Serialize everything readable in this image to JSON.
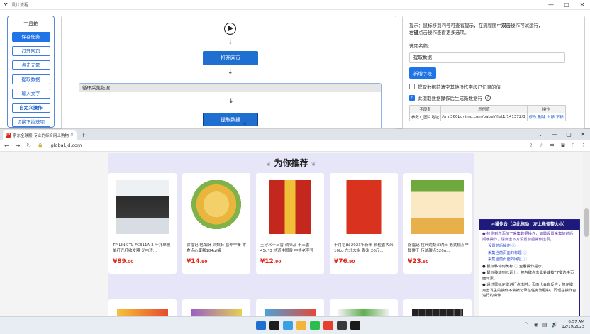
{
  "app": {
    "title": "设计流程",
    "minimize": "—",
    "maximize": "▢",
    "close": "✕",
    "toolbox": {
      "title": "工具箱",
      "buttons": [
        "保存任务",
        "打开网页",
        "点击元素",
        "提取数据",
        "输入文字",
        "自定义操作",
        "切换下拉选项"
      ]
    },
    "flow": {
      "nodes": {
        "open_page": "打开网页",
        "loop": "循环采集数据",
        "extract": "提取数据"
      },
      "arrow": "↓"
    },
    "props": {
      "tip_prefix": "提示：鼠标移到问号可查看提示，在流程图中",
      "tip_bold1": "双击",
      "tip_mid": "操作可试运行，",
      "tip_bold2": "右键",
      "tip_suffix": "点击操作查看更多选项。",
      "option_name_label": "选项名称:",
      "option_name_value": "提取数据",
      "add_field_button": "新增字段",
      "checkbox1": "提取数据前清空其他操作字段已记录的值",
      "checkbox2": "此提取数据操作后生成新数据行",
      "info_glyph": "?",
      "table": {
        "headers": [
          "字段名",
          "示例值",
          "操作"
        ],
        "rows": [
          [
            "参数1_图片地址",
            "//m.360buyimg.com/babel/jfs/t1/141372/3",
            "修改 删除 上移 下移"
          ]
        ]
      }
    }
  },
  "browser": {
    "tab_title": "京东全球版-专业的综合网上购物",
    "tab_favicon": "JD",
    "tab_close": "✕",
    "new_tab": "+",
    "nav": {
      "back": "←",
      "forward": "→",
      "reload": "↻",
      "lock": "🔒"
    },
    "url": "global.jd.com",
    "window_controls": {
      "dropdown": "⌄",
      "minimize": "—",
      "maximize": "▢",
      "close": "✕"
    },
    "toolbar_icons": [
      "⇪",
      "☆",
      "✱",
      "▣",
      "▯",
      "⋮"
    ],
    "section_title": "为你推荐",
    "products": [
      {
        "name": "TP-LINK TL-FC311A-3 千兆单模单纤光纤收发器 光电转...",
        "price_symbol": "¥",
        "price_int": "89",
        "price_dec": ".00",
        "colors": [
          "#2b2b2b",
          "#d8dde4"
        ]
      },
      {
        "name": "徐福记 包馅酥 凤梨酥 营养早餐 零食点心蛋糕184g/袋",
        "price_symbol": "¥",
        "price_int": "14",
        "price_dec": ".90",
        "colors": [
          "#e9b53c",
          "#7fb34a"
        ]
      },
      {
        "name": "王守义十三香 调味品 十三香45g*3 地道中国香 中华老字号",
        "price_symbol": "¥",
        "price_int": "12",
        "price_dec": ".90",
        "colors": [
          "#c3271d",
          "#f0c038"
        ]
      },
      {
        "name": "十月稻田 2023年新米 长粒香大米 10kg 东北大米 香米 20斤...",
        "price_symbol": "¥",
        "price_int": "76",
        "price_dec": ".90",
        "colors": [
          "#d9321f",
          "#f3e7c9"
        ]
      },
      {
        "name": "徐福记 拉典炖梨沙琪玛 老式糕点早餐饼干 传统甜点526g...",
        "price_symbol": "¥",
        "price_int": "23",
        "price_dec": ".90",
        "colors": [
          "#e8b04a",
          "#6fa83c"
        ]
      }
    ],
    "console": {
      "title": "✍操作台（点此拖动，左上角调整大小）",
      "lines": [
        {
          "kind": "purple",
          "text": "● 检测到您添加了采集数据操作，如需设置采集的前后顺序操作，请点击下方设置前后操作选项。"
        },
        {
          "kind": "link",
          "text": "设置前后操作 ⓘ"
        },
        {
          "kind": "link",
          "text": "采集当前页面的标题 ⓘ"
        },
        {
          "kind": "link",
          "text": "采集当前页面的网址 ⓘ"
        },
        {
          "kind": "black",
          "text": "● 鼠标移动到黄标 ⓘ 查看操作提示。"
        },
        {
          "kind": "black",
          "text": "● 鼠标移动到元素上，按右键点击此处或按F7键选中页面元素。"
        },
        {
          "kind": "black",
          "text": "● 通过鼠标左键进行点击时，页面也会有反应，但左键点击发生的操作不会被记录在任务流程中，同理在操作台进行的操作..."
        }
      ]
    }
  },
  "taskbar": {
    "chevron": "^",
    "tray_symbols": [
      "◉",
      "▤",
      "🔊"
    ],
    "time": "6:57 AM",
    "date": "12/19/2023",
    "app_colors": [
      "#1d1d1d",
      "#3aa0e6",
      "#f3b43a",
      "#2dbd4e",
      "#e83e2e",
      "#3a3a3a",
      "#1a1a1a"
    ]
  }
}
